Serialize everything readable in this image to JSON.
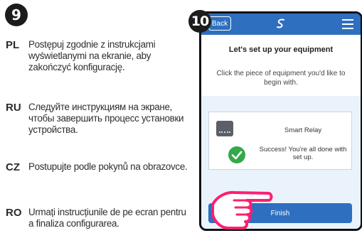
{
  "steps": {
    "first": "9",
    "second": "10"
  },
  "languages": [
    {
      "code": "PL",
      "text": "Postępuj zgodnie z instrukcjami wyświetlanymi na ekranie, aby zakończyć konfigurację."
    },
    {
      "code": "RU",
      "text": "Следуйте инструкциям на экране, чтобы завершить процесс установки устройства."
    },
    {
      "code": "CZ",
      "text": "Postupujte podle pokynů na obrazovce."
    },
    {
      "code": "RO",
      "text": "Urmați instrucțiunile de pe ecran pentru a finaliza configurarea."
    }
  ],
  "phone": {
    "back_label": "Back",
    "logo_icon": "brand-logo-icon",
    "menu_icon": "hamburger-menu-icon",
    "title": "Let's set up your equipment",
    "instruction": "Click the piece of equipment you'd like to begin with.",
    "device_name": "Smart Relay",
    "success_message": "Success! You're all done with set up.",
    "finish_label": "Finish"
  },
  "colors": {
    "header_blue": "#2f6fc0",
    "success_green": "#35a84a",
    "hand_pink": "#ff1f6e"
  }
}
